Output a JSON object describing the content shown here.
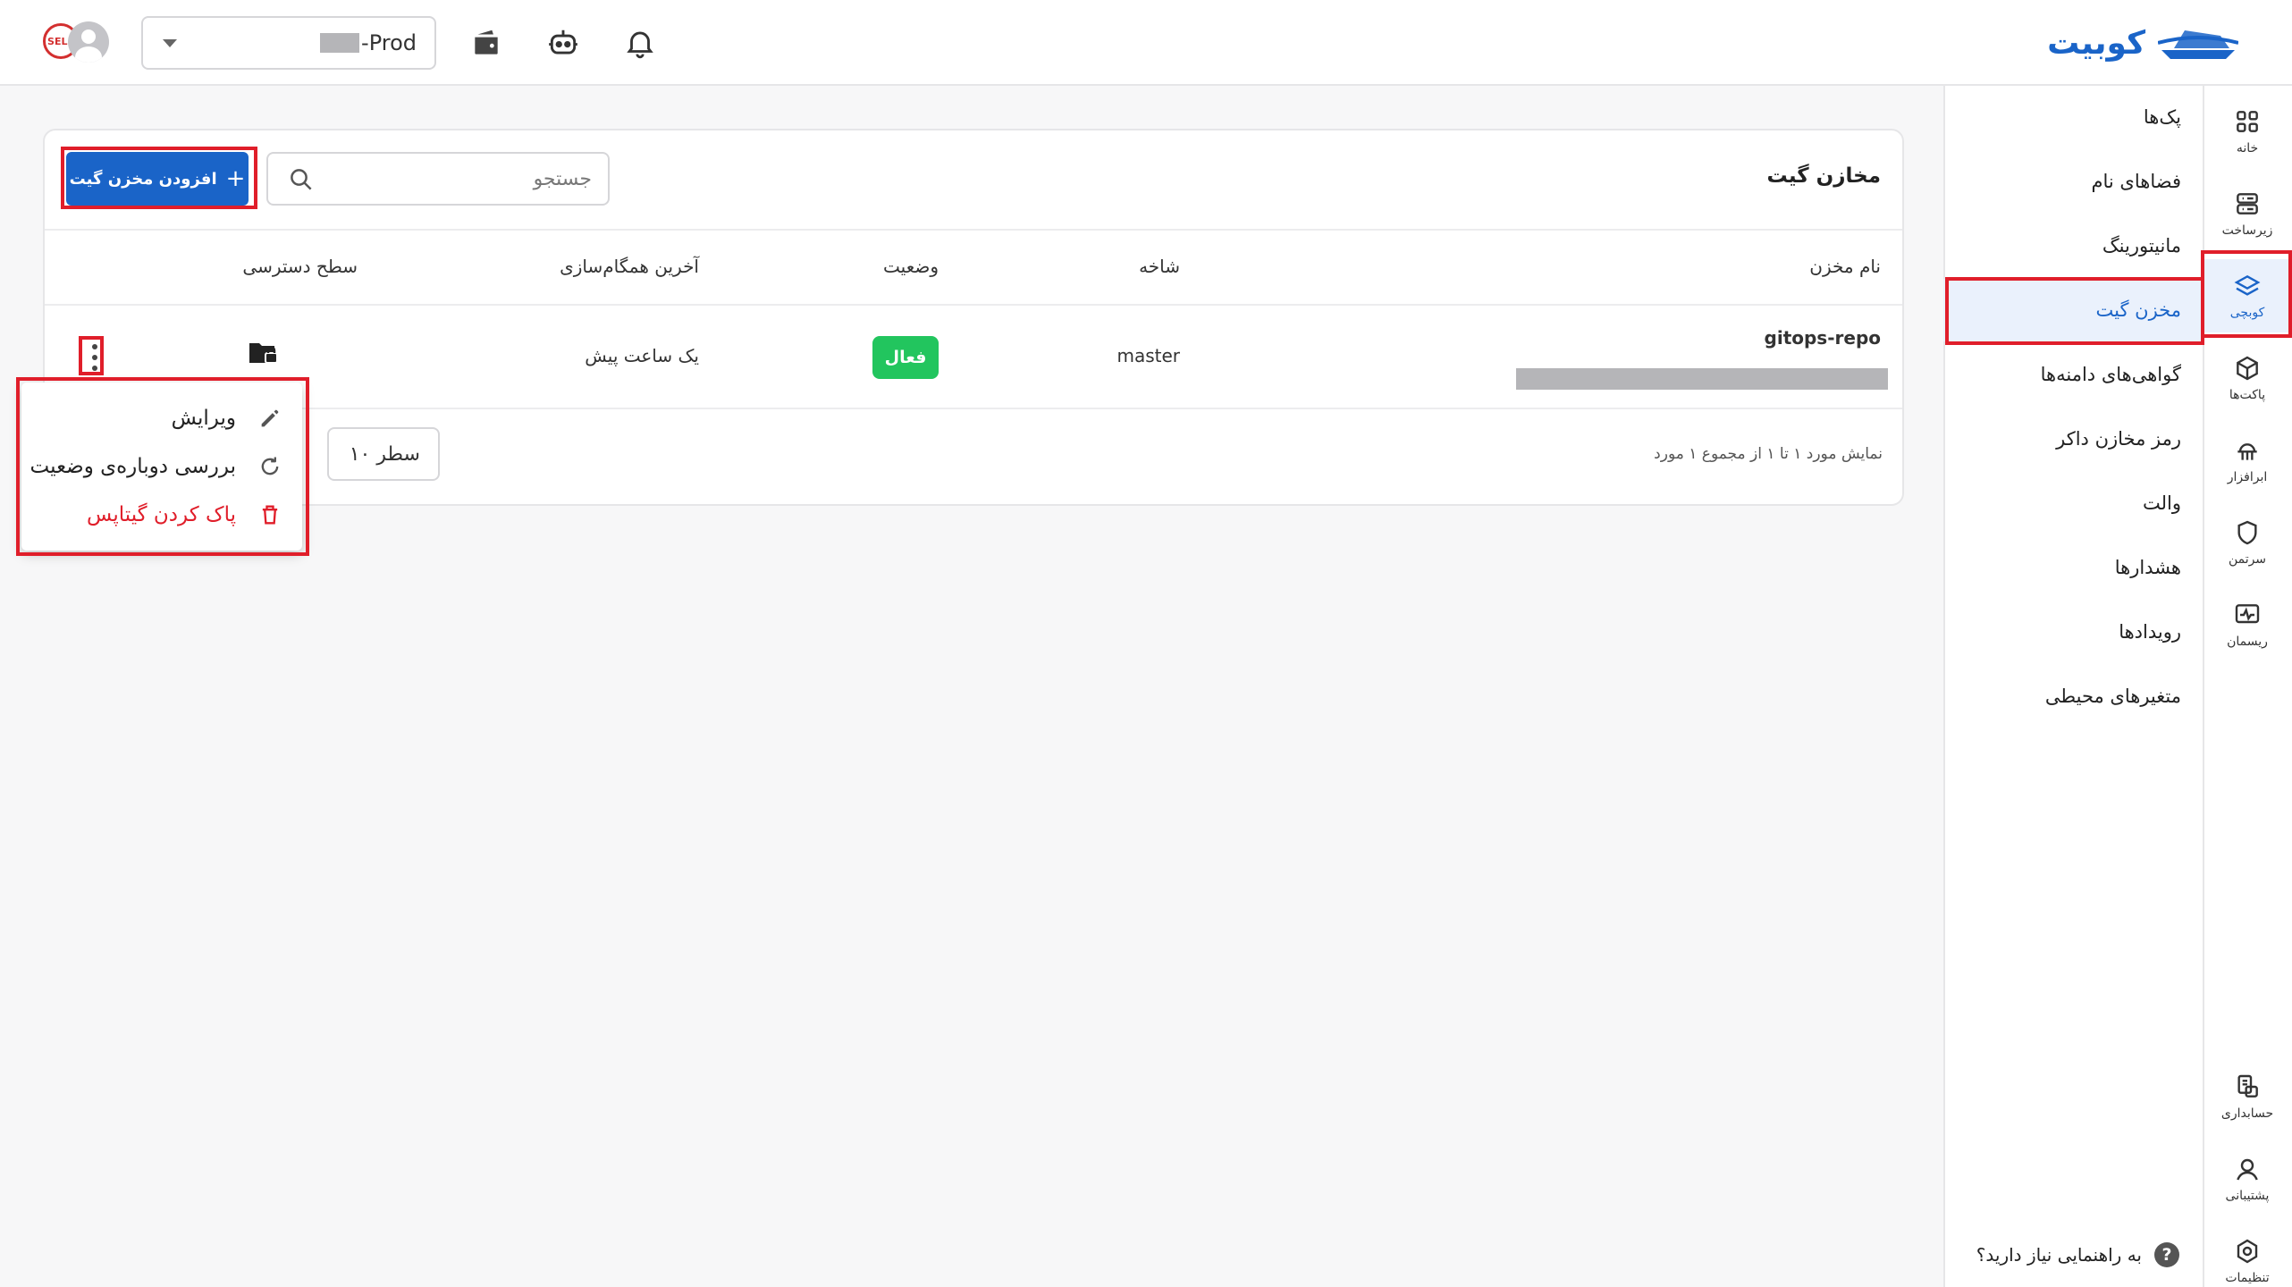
{
  "app": {
    "logo_text": "کوبیت",
    "brand_color": "#1a64c8"
  },
  "header": {
    "environment": {
      "value": "-Prod"
    },
    "icons": [
      "bell-icon",
      "robot-icon",
      "wallet-icon"
    ],
    "avatar_badge": "SELF"
  },
  "rail": {
    "items": [
      {
        "label": "خانه",
        "icon": "grid-icon"
      },
      {
        "label": "زیرساخت",
        "icon": "server-icon"
      },
      {
        "label": "کوبچی",
        "icon": "layers-icon",
        "active": true
      },
      {
        "label": "پاکت‌ها",
        "icon": "cube-icon"
      },
      {
        "label": "ابرافزار",
        "icon": "cloud-app-icon"
      },
      {
        "label": "سرتمن",
        "icon": "shield-icon"
      },
      {
        "label": "ریسمان",
        "icon": "pulse-icon"
      },
      {
        "label": "حسابداری",
        "icon": "accounting-icon"
      },
      {
        "label": "پشتیبانی",
        "icon": "support-icon"
      },
      {
        "label": "تنظیمات",
        "icon": "settings-icon"
      }
    ]
  },
  "subnav": {
    "items": [
      {
        "label": "پک‌ها"
      },
      {
        "label": "فضاهای نام"
      },
      {
        "label": "مانیتورینگ"
      },
      {
        "label": "مخزن گیت",
        "active": true
      },
      {
        "label": "گواهی‌های دامنه‌ها"
      },
      {
        "label": "رمز مخازن داکر"
      },
      {
        "label": "والت"
      },
      {
        "label": "هشدارها"
      },
      {
        "label": "رویدادها"
      },
      {
        "label": "متغیرهای محیطی"
      }
    ],
    "help": "به راهنمایی نیاز دارید؟"
  },
  "main": {
    "title": "مخازن گیت",
    "search_placeholder": "جستجو",
    "add_button": "افزودن مخزن گیت",
    "table": {
      "columns": [
        "نام مخزن",
        "شاخه",
        "وضعیت",
        "آخرین همگام‌سازی",
        "سطح دسترسی"
      ],
      "rows": [
        {
          "name": "gitops-repo",
          "branch": "master",
          "status": "فعال",
          "last_sync": "یک ساعت پیش",
          "access": "private-folder-icon"
        }
      ]
    },
    "pagination": {
      "summary": "نمایش مورد ۱ تا ۱ از مجموع ۱ مورد",
      "rows_per_page": "۱۰ سطر"
    },
    "context_menu": {
      "items": [
        {
          "label": "ویرایش",
          "icon": "edit-icon"
        },
        {
          "label": "بررسی دوباره‌ی وضعیت",
          "icon": "refresh-icon"
        },
        {
          "label": "پاک کردن گیتاپس",
          "icon": "trash-icon",
          "danger_color": "#e01e2a"
        }
      ]
    }
  },
  "colors": {
    "status_active": "#22c55e",
    "highlight": "#e01e2a"
  }
}
